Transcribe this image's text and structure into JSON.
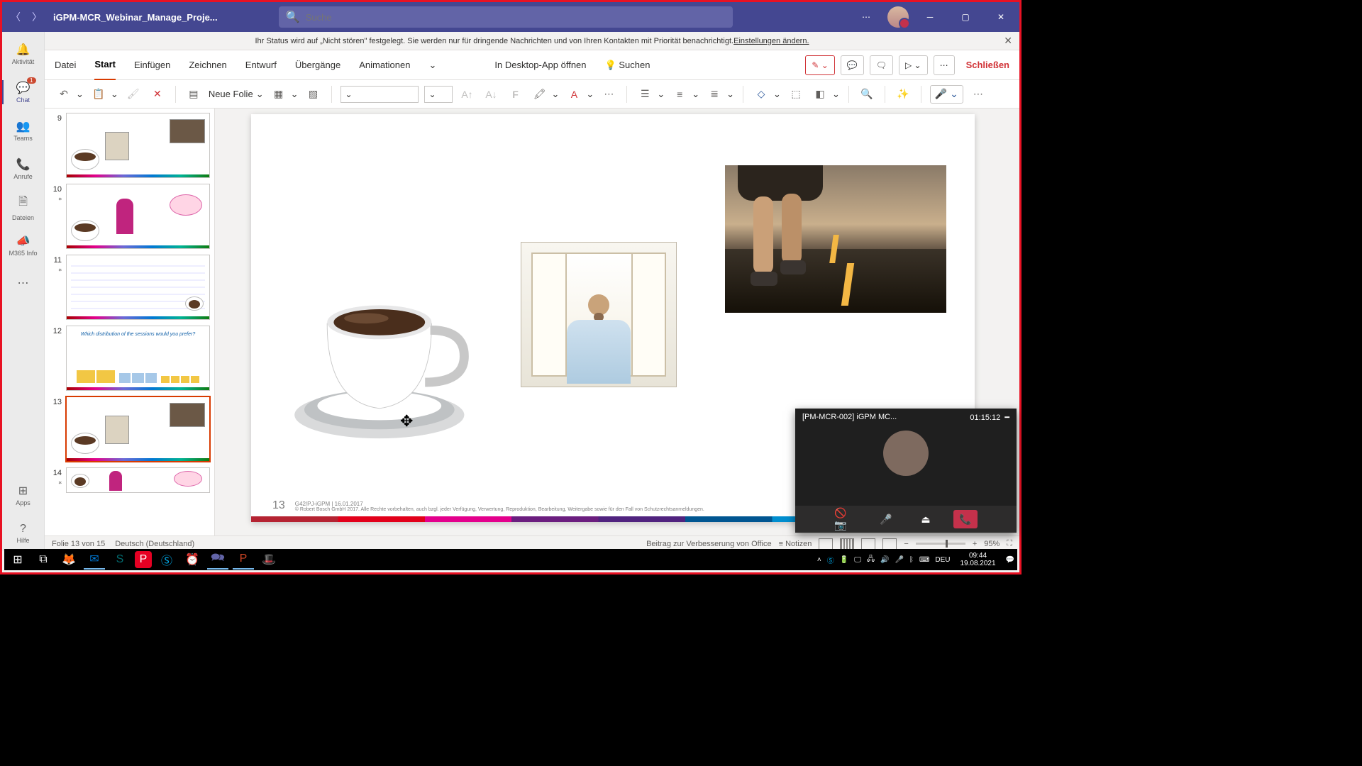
{
  "titlebar": {
    "doc_title": "iGPM-MCR_Webinar_Manage_Proje..."
  },
  "search": {
    "placeholder": "Suche"
  },
  "rail": {
    "items": [
      {
        "label": "Aktivität",
        "icon": "🔔"
      },
      {
        "label": "Chat",
        "icon": "💬",
        "badge": "1"
      },
      {
        "label": "Teams",
        "icon": "👥"
      },
      {
        "label": "Anrufe",
        "icon": "📞"
      },
      {
        "label": "Dateien",
        "icon": "🗎"
      },
      {
        "label": "M365 Info",
        "icon": "📣"
      }
    ],
    "more": "⋯",
    "apps": {
      "label": "Apps",
      "icon": "⊞"
    },
    "help": {
      "label": "Hilfe",
      "icon": "?"
    }
  },
  "status_notif": {
    "text_a": "Ihr Status wird auf „Nicht stören\" festgelegt. Sie werden nur für dringende Nachrichten und von Ihren Kontakten mit Priorität benachrichtigt. ",
    "link": "Einstellungen ändern."
  },
  "ribbon": {
    "file": "Datei",
    "tabs": [
      "Start",
      "Einfügen",
      "Zeichnen",
      "Entwurf",
      "Übergänge",
      "Animationen"
    ],
    "open_desktop": "In Desktop-App öffnen",
    "search_label": "Suchen",
    "close": "Schließen"
  },
  "toolbar": {
    "new_slide": "Neue Folie"
  },
  "thumbs": [
    {
      "n": "9"
    },
    {
      "n": "10"
    },
    {
      "n": "11"
    },
    {
      "n": "12"
    },
    {
      "n": "13",
      "selected": true
    },
    {
      "n": "14"
    }
  ],
  "slide": {
    "number": "13",
    "meta": "G42/PJ-iGPM | 16.01.2017",
    "copyright": "© Robert Bosch GmbH 2017. Alle Rechte vorbehalten, auch bzgl. jeder Verfügung, Verwertung, Reproduktion, Bearbeitung, Weitergabe sowie für den Fall von Schutzrechtsanmeldungen."
  },
  "ppt_status": {
    "slide_count": "Folie 13 von 15",
    "lang": "Deutsch (Deutschland)",
    "feedback": "Beitrag zur Verbesserung von Office",
    "notes": "Notizen",
    "zoom": "95%"
  },
  "call": {
    "title": "[PM-MCR-002] iGPM MC...",
    "time": "01:15:12"
  },
  "taskbar": {
    "lang": "DEU",
    "time": "09:44",
    "date": "19.08.2021"
  }
}
